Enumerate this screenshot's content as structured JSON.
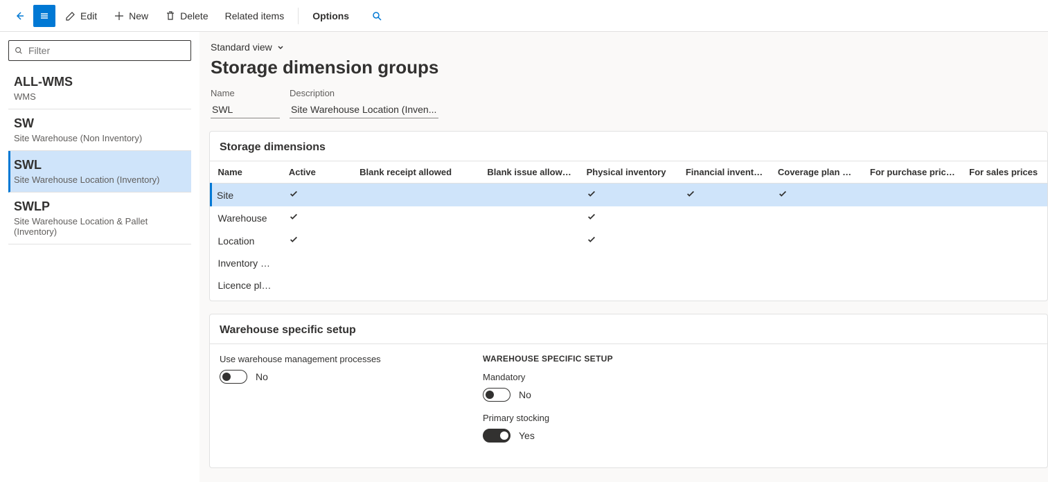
{
  "toolbar": {
    "edit": "Edit",
    "new": "New",
    "delete": "Delete",
    "related": "Related items",
    "options": "Options"
  },
  "sidebar": {
    "filter_placeholder": "Filter",
    "items": [
      {
        "title": "ALL-WMS",
        "subtitle": "WMS"
      },
      {
        "title": "SW",
        "subtitle": "Site Warehouse (Non Inventory)"
      },
      {
        "title": "SWL",
        "subtitle": "Site Warehouse Location (Inventory)"
      },
      {
        "title": "SWLP",
        "subtitle": "Site Warehouse Location & Pallet (Inventory)"
      }
    ]
  },
  "main": {
    "view": "Standard view",
    "title": "Storage dimension groups",
    "name_label": "Name",
    "name_value": "SWL",
    "desc_label": "Description",
    "desc_value": "Site Warehouse Location (Inven..."
  },
  "grid": {
    "title": "Storage dimensions",
    "cols": [
      "Name",
      "Active",
      "Blank receipt allowed",
      "Blank issue allowed",
      "Physical inventory",
      "Financial inventory",
      "Coverage plan by di...",
      "For purchase prices",
      "For sales prices"
    ],
    "rows": [
      {
        "name": "Site",
        "active": true,
        "blank_receipt": false,
        "blank_issue": false,
        "physical": true,
        "financial": true,
        "coverage": true,
        "purchase": false,
        "sales": false
      },
      {
        "name": "Warehouse",
        "active": true,
        "blank_receipt": false,
        "blank_issue": false,
        "physical": true,
        "financial": false,
        "coverage": false,
        "purchase": false,
        "sales": false
      },
      {
        "name": "Location",
        "active": true,
        "blank_receipt": false,
        "blank_issue": false,
        "physical": true,
        "financial": false,
        "coverage": false,
        "purchase": false,
        "sales": false
      },
      {
        "name": "Inventory st...",
        "active": false,
        "blank_receipt": false,
        "blank_issue": false,
        "physical": false,
        "financial": false,
        "coverage": false,
        "purchase": false,
        "sales": false
      },
      {
        "name": "Licence plate",
        "active": false,
        "blank_receipt": false,
        "blank_issue": false,
        "physical": false,
        "financial": false,
        "coverage": false,
        "purchase": false,
        "sales": false
      }
    ]
  },
  "setup": {
    "title": "Warehouse specific setup",
    "use_wms_label": "Use warehouse management processes",
    "use_wms_value": "No",
    "heading": "WAREHOUSE SPECIFIC SETUP",
    "mandatory_label": "Mandatory",
    "mandatory_value": "No",
    "primary_label": "Primary stocking",
    "primary_value": "Yes"
  }
}
